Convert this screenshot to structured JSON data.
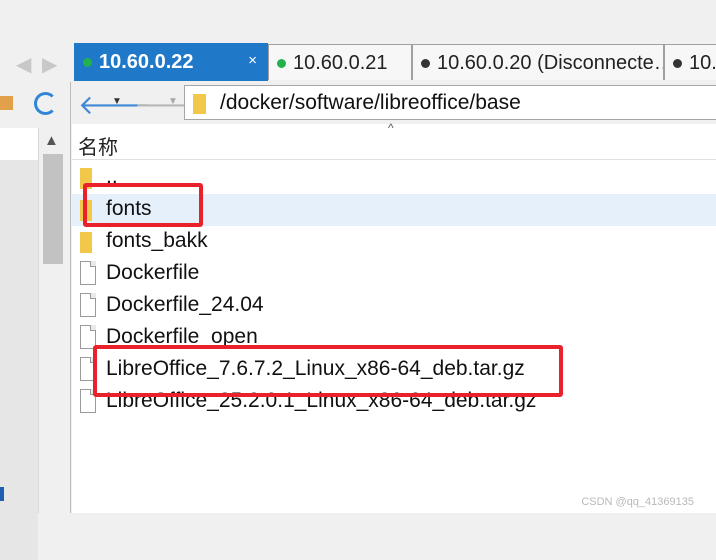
{
  "tabs": [
    {
      "label": "10.60.0.22",
      "status": "connected",
      "active": true,
      "close": "×"
    },
    {
      "label": "10.60.0.21",
      "status": "connected",
      "active": false
    },
    {
      "label": "10.60.0.20 (Disconnecte…",
      "status": "disconnected",
      "active": false
    },
    {
      "label": "10.…",
      "status": "disconnected",
      "active": false
    }
  ],
  "tab_nav": {
    "prev": "◀",
    "next": "▶"
  },
  "status_colors": {
    "connected": "#22b14c",
    "disconnected": "#333333"
  },
  "address": {
    "path": "/docker/software/libreoffice/base",
    "back": "🡐",
    "forward": "🡒",
    "dropdown": "▼"
  },
  "filelist": {
    "sort_indicator": "^",
    "column_name": "名称",
    "rows": [
      {
        "name": "..",
        "type": "parent-folder"
      },
      {
        "name": "fonts",
        "type": "folder",
        "selected": true,
        "highlighted": true
      },
      {
        "name": "fonts_bakk",
        "type": "folder"
      },
      {
        "name": "Dockerfile",
        "type": "file"
      },
      {
        "name": "Dockerfile_24.04",
        "type": "file"
      },
      {
        "name": "Dockerfile_open",
        "type": "file"
      },
      {
        "name": "LibreOffice_7.6.7.2_Linux_x86-64_deb.tar.gz",
        "type": "file",
        "highlighted": true
      },
      {
        "name": "LibreOffice_25.2.0.1_Linux_x86-64_deb.tar.gz",
        "type": "file"
      }
    ]
  },
  "left_pane": {
    "scroll_up": "▲"
  },
  "highlight_color": "#e8212a",
  "watermark": "CSDN @qq_41369135"
}
